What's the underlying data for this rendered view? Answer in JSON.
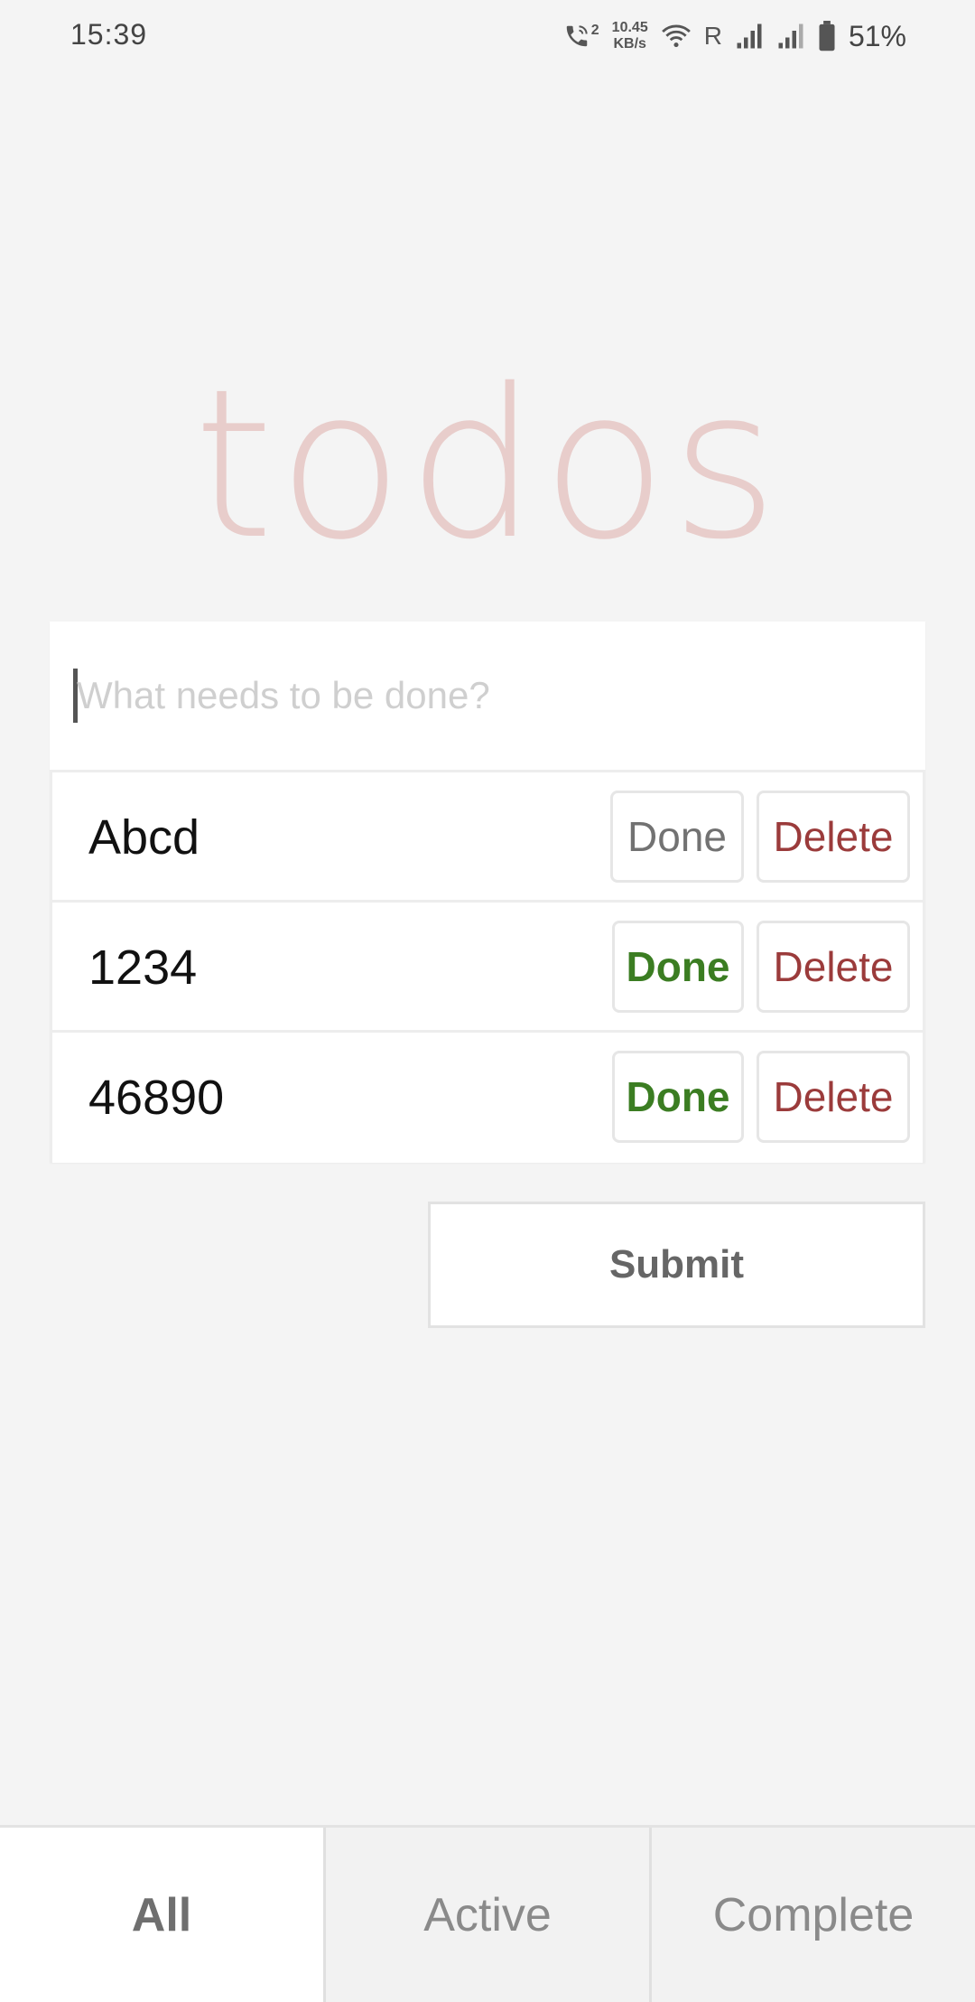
{
  "status_bar": {
    "time": "15:39",
    "call_indicator": "2",
    "net_speed_value": "10.45",
    "net_speed_unit": "KB/s",
    "roaming": "R",
    "battery_percent": "51%",
    "icons": [
      "call-icon",
      "wifi-icon",
      "signal-icon",
      "signal-icon",
      "battery-icon"
    ]
  },
  "app": {
    "title": "todos"
  },
  "new_todo": {
    "placeholder": "What needs to be done?",
    "value": ""
  },
  "todos": [
    {
      "text": "Abcd",
      "done_label": "Done",
      "delete_label": "Delete",
      "completed": true
    },
    {
      "text": "1234",
      "done_label": "Done",
      "delete_label": "Delete",
      "completed": false
    },
    {
      "text": "46890",
      "done_label": "Done",
      "delete_label": "Delete",
      "completed": false
    }
  ],
  "submit_label": "Submit",
  "filters": {
    "all": "All",
    "active": "Active",
    "complete": "Complete",
    "selected": "all"
  },
  "colors": {
    "title": "#e8cdcb",
    "done_active": "#3b7d22",
    "done_inactive": "#727272",
    "delete": "#9b3b3b",
    "background": "#f4f4f4"
  }
}
